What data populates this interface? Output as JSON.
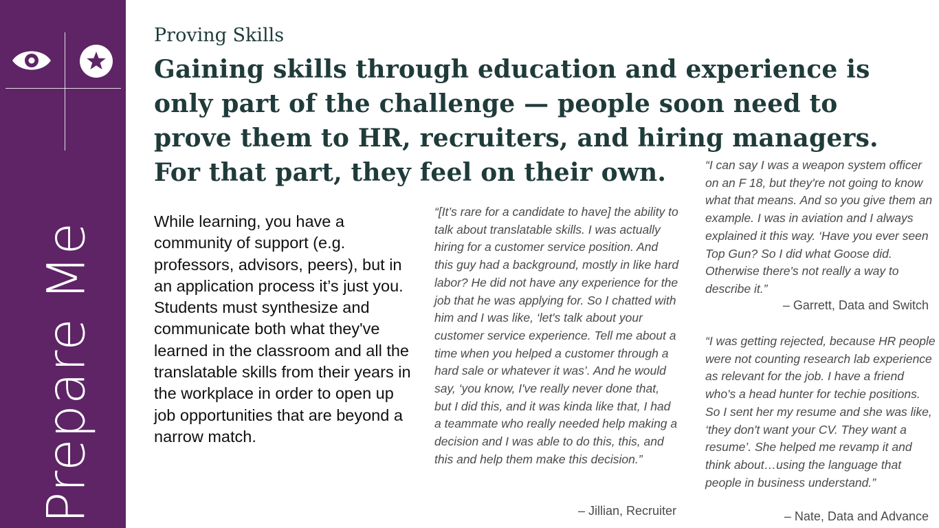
{
  "sidebar": {
    "title": "Prepare Me",
    "icons": [
      "eye-icon",
      "star-icon"
    ],
    "background_color": "#5e2466"
  },
  "main": {
    "section_label": "Proving Skills",
    "headline": "Gaining skills through education and experience is only part of the challenge — people soon need to prove them to HR, recruiters, and hiring managers. For that part, they feel on their own.",
    "body": "While learning, you have a community of support (e.g. professors, advisors, peers), but in an application process it’s just you. Students must synthesize and communicate both what they've learned in the classroom and all the translatable skills from their years in the workplace in order to open up job opportunities that are beyond a narrow match."
  },
  "quotes": [
    {
      "text": "“[It’s rare for a candidate to have] the ability to talk about translatable skills. I was actually hiring for a customer service position. And this guy had a background, mostly in like hard labor? He did not have any experience for the job that he was applying for. So I chatted with him and I was like, ‘let's talk about your customer service experience. Tell me about a time when you helped a customer through a hard sale or whatever it was’. And he would say, ‘you know, I've really never done that, but I did this, and it was kinda like that, I had a teammate who really needed help making a decision and I was able to do this, this, and this and help them make this decision.”",
      "attribution": "– Jillian, Recruiter"
    },
    {
      "text": "“I can say I was a weapon system officer on an F 18, but they're not going to know what that means. And so you give them an example. I was in aviation and I always explained it this way. ‘Have you ever seen Top Gun? So I did what Goose did. Otherwise there's not really a way to describe it.”",
      "attribution": "– Garrett, Data and Switch"
    },
    {
      "text": "“I was getting rejected, because HR people were not counting research lab experience as relevant for the job. I have a friend who's a head hunter for techie positions. So I sent her my resume and she was like, ‘they don't want your CV. They want a resume’. She helped me revamp it and think about…using the language that people in business understand.”",
      "attribution": "– Nate, Data and Advance"
    }
  ]
}
